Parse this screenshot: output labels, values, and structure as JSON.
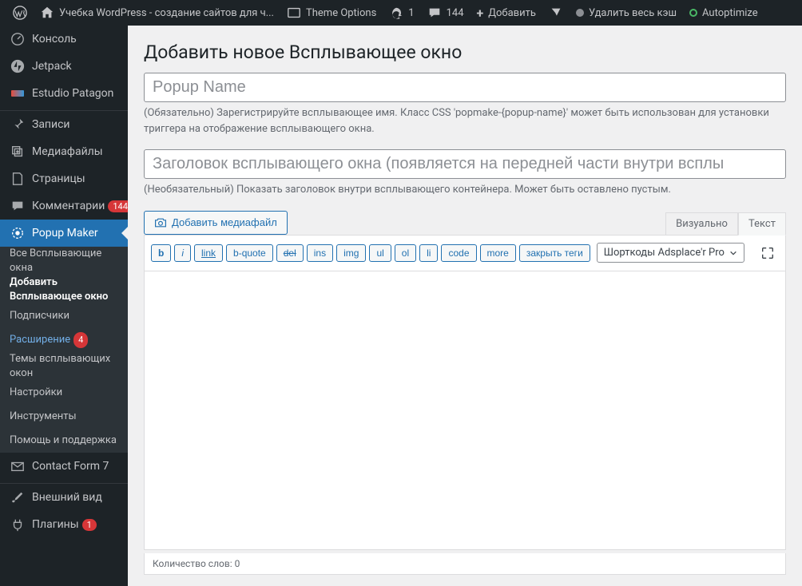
{
  "topbar": {
    "site_name": "Учебка WordPress - создание сайтов для ч...",
    "theme_options": "Theme Options",
    "updates": "1",
    "comments": "144",
    "add_new": "Добавить",
    "clear_cache": "Удалить весь кэш",
    "autoptimize": "Autoptimize"
  },
  "sidebar": {
    "console": "Консоль",
    "jetpack": "Jetpack",
    "estudio": "Estudio Patagon",
    "posts": "Записи",
    "media": "Медиафайлы",
    "pages": "Страницы",
    "comments": "Комментарии",
    "comments_badge": "144",
    "popup_maker": "Popup Maker",
    "sub_all": "Все Всплывающие окна",
    "sub_add": "Добавить Всплывающее окно",
    "sub_subscribers": "Подписчики",
    "sub_extend": "Расширение",
    "sub_extend_badge": "4",
    "sub_themes": "Темы всплывающих окон",
    "sub_settings": "Настройки",
    "sub_tools": "Инструменты",
    "sub_help": "Помощь и поддержка",
    "cf7": "Contact Form 7",
    "appearance": "Внешний вид",
    "plugins": "Плагины",
    "plugins_badge": "1"
  },
  "content": {
    "heading": "Добавить новое Всплывающее окно",
    "name_placeholder": "Popup Name",
    "name_help": "(Обязательно) Зарегистрируйте всплывающее имя. Класс CSS 'popmake-{popup-name}' может быть использован для установки триггера на отображение всплывающего окна.",
    "title_placeholder": "Заголовок всплывающего окна (появляется на передней части внутри всплы",
    "title_help": "(Необязательный) Показать заголовок внутри всплывающего контейнера. Может быть оставлено пустым.",
    "add_media": "Добавить медиафайл",
    "tab_visual": "Визуально",
    "tab_text": "Текст",
    "qt": {
      "b": "b",
      "i": "i",
      "link": "link",
      "bquote": "b-quote",
      "del": "del",
      "ins": "ins",
      "img": "img",
      "ul": "ul",
      "ol": "ol",
      "li": "li",
      "code": "code",
      "more": "more",
      "close": "закрыть теги"
    },
    "shortcodes": "Шорткоды Adsplace'r Pro",
    "word_count": "Количество слов: 0"
  }
}
